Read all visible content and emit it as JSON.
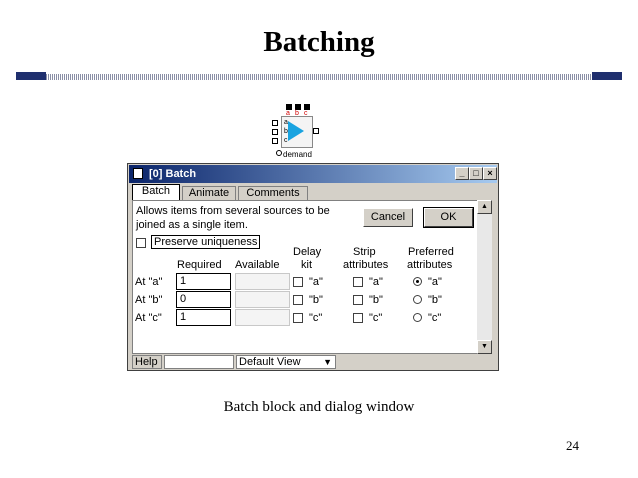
{
  "slide": {
    "title": "Batching",
    "caption": "Batch block and dialog window",
    "page_number": "24"
  },
  "block_icon": {
    "top_labels": [
      "a",
      "b",
      "c"
    ],
    "inner_labels": [
      "a",
      "b",
      "c"
    ],
    "demand_label": "demand"
  },
  "dialog": {
    "title": "[0]   Batch",
    "window_buttons": {
      "minimize": "_",
      "maximize": "□",
      "close": "×"
    },
    "tabs": [
      "Batch",
      "Animate",
      "Comments"
    ],
    "description_line1": "Allows items from several sources to be",
    "description_line2": "joined as a single item.",
    "cancel_label": "Cancel",
    "ok_label": "OK",
    "preserve_label": "Preserve uniqueness",
    "headers": {
      "required": "Required",
      "available": "Available",
      "delay1": "Delay",
      "delay2": "kit",
      "strip1": "Strip",
      "strip2": "attributes",
      "pref1": "Preferred",
      "pref2": "attributes"
    },
    "rows": [
      {
        "label": "At \"a\"",
        "required": "1",
        "option": "\"a\""
      },
      {
        "label": "At \"b\"",
        "required": "0",
        "option": "\"b\""
      },
      {
        "label": "At \"c\"",
        "required": "1",
        "option": "\"c\""
      }
    ],
    "preferred_selected": "a",
    "help_label": "Help",
    "view_label": "Default View"
  }
}
